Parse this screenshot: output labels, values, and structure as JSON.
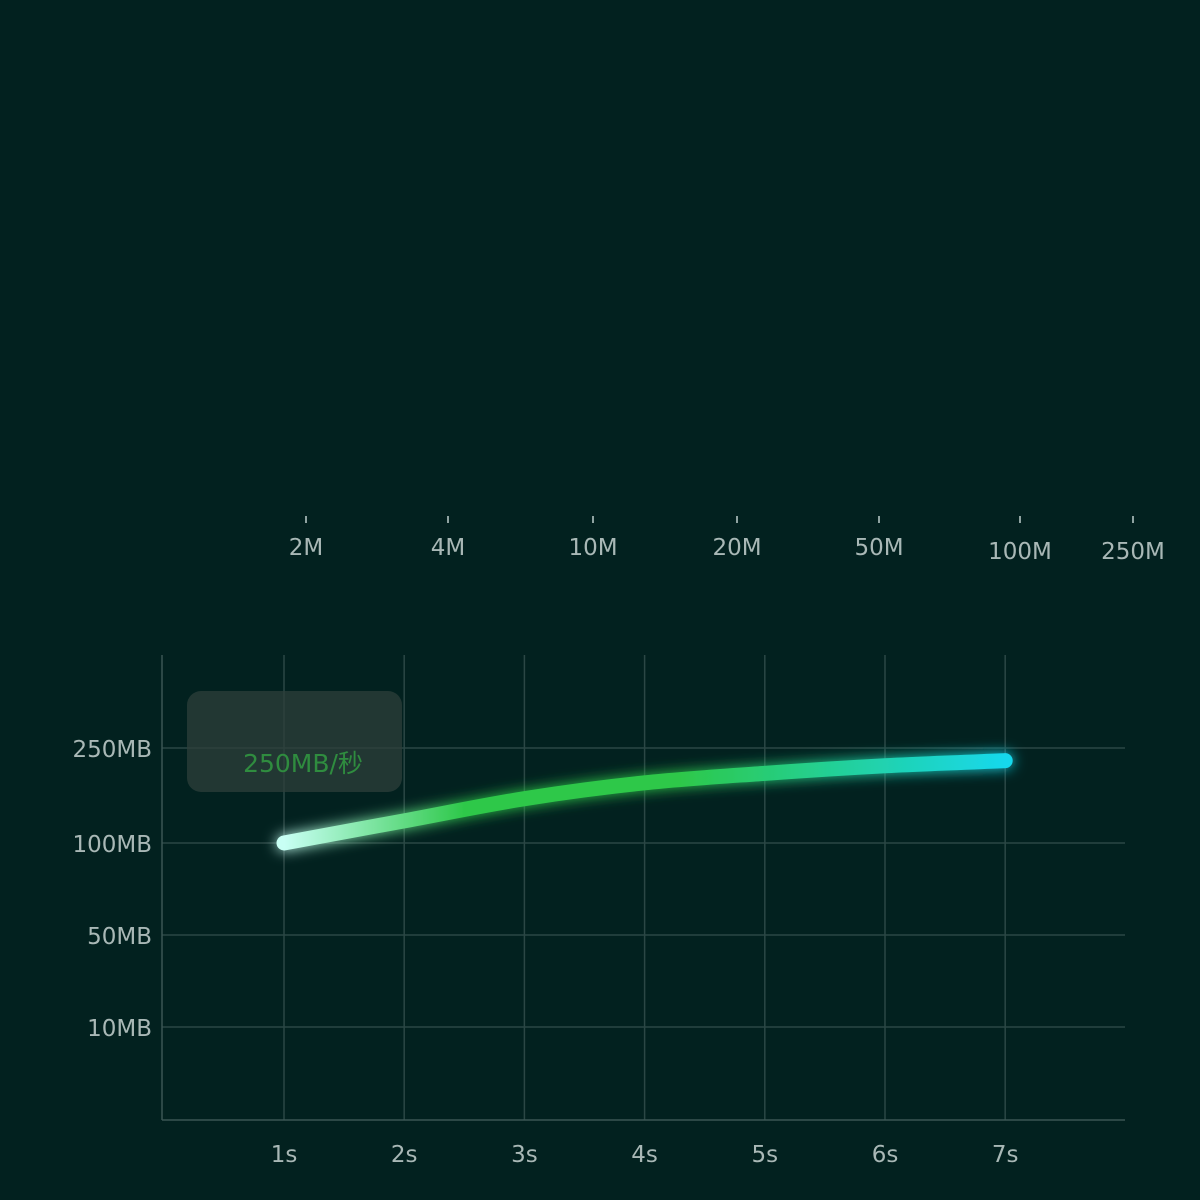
{
  "scale": {
    "labels": [
      "2M",
      "4M",
      "10M",
      "20M",
      "50M",
      "100M",
      "250M"
    ],
    "colors": {
      "start": "#2ec84a",
      "end": "#18d8ec"
    }
  },
  "chart_data": {
    "type": "line",
    "x": [
      1,
      2,
      3,
      4,
      5,
      6,
      7
    ],
    "xticks": [
      "1s",
      "2s",
      "3s",
      "4s",
      "5s",
      "6s",
      "7s"
    ],
    "yticks": [
      "10MB",
      "50MB",
      "100MB",
      "250MB"
    ],
    "series": [
      {
        "values": [
          100,
          135,
          170,
          195,
          210,
          222,
          230
        ]
      }
    ],
    "annotation": {
      "text": "250MB/秒",
      "color": "#2f8c3f"
    },
    "grid": true,
    "colors": {
      "line_start": "#c8fff4",
      "line_mid": "#2ec84a",
      "line_end": "#18d8ec",
      "grid": "#2b4745",
      "background": "#02211f"
    }
  }
}
